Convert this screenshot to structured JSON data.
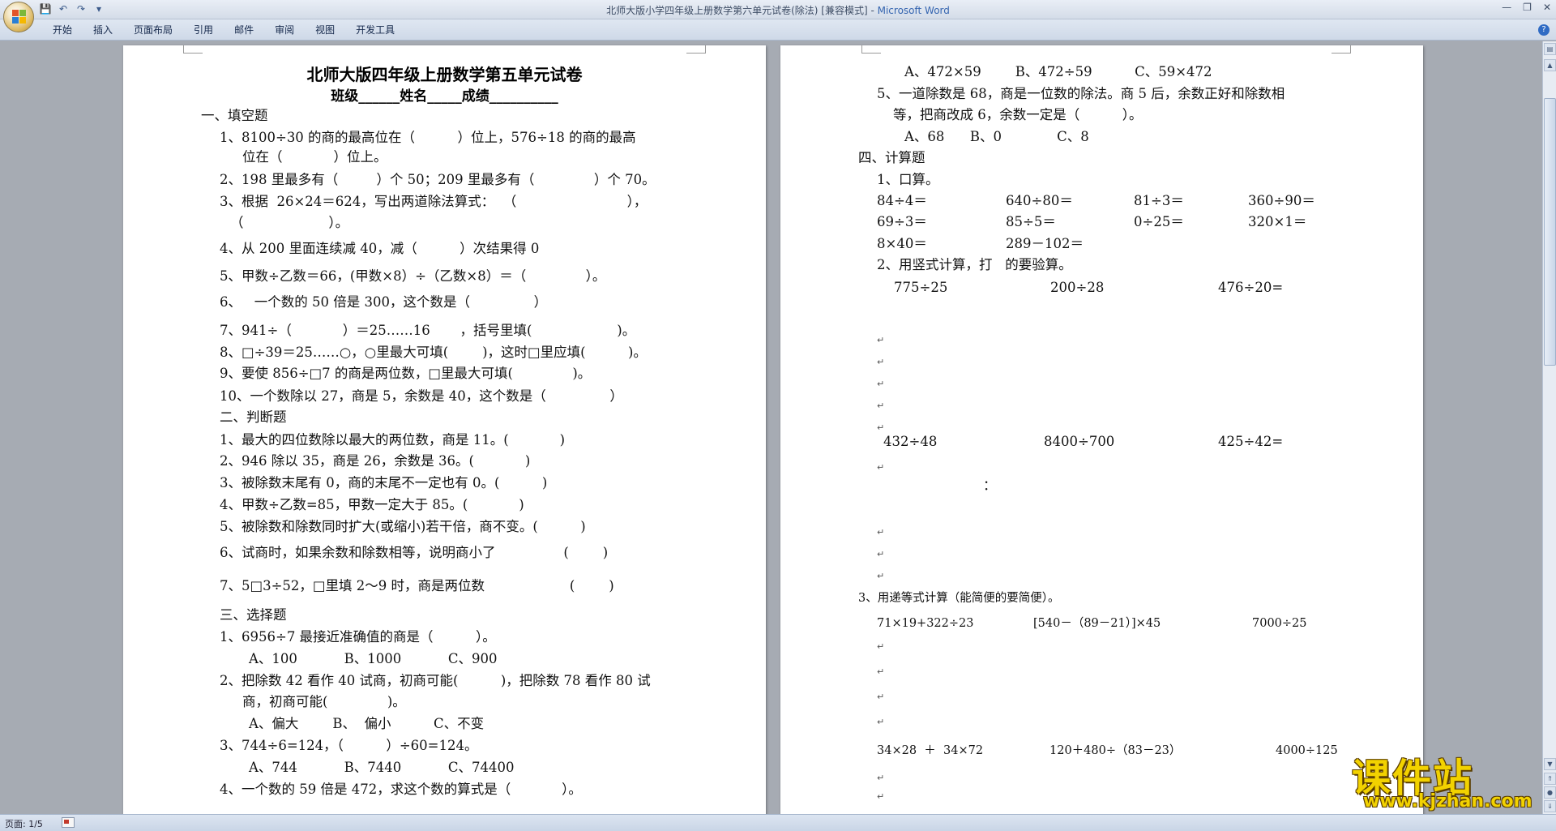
{
  "window": {
    "title": "北师大版小学四年级上册数学第六单元试卷(除法) [兼容模式] - ",
    "app_name": "Microsoft Word",
    "controls": [
      "—",
      "❐",
      "✕"
    ]
  },
  "quick_access": {
    "save_icon": "save-icon",
    "undo_icon": "undo-icon",
    "redo_icon": "redo-icon",
    "more": "▾"
  },
  "ribbon": {
    "tabs": [
      "开始",
      "插入",
      "页面布局",
      "引用",
      "邮件",
      "审阅",
      "视图",
      "开发工具"
    ],
    "help": "?"
  },
  "page1": {
    "title": "北师大版四年级上册数学第五单元试卷",
    "subtitle": "班级______姓名_____成绩__________",
    "lines": [
      "一、填空题",
      "1、8100÷30 的商的最高位在（          ）位上，576÷18 的商的最高",
      "位在（            ）位上。",
      "2、198 里最多有（         ）个 50；209 里最多有（              ）个 70。",
      "3、根据  26×24＝624，写出两道除法算式：  （                          ），",
      "（                    ）。",
      "4、从 200 里面连续减 40，减（          ）次结果得 0",
      "5、甲数÷乙数＝66，(甲数×8）÷（乙数×8）＝（              ）。",
      "6、   一个数的 50 倍是 300，这个数是（               ）",
      "7、941÷（            ）＝25……16       ，括号里填(                    )。",
      "8、□÷39＝25……○，○里最大可填(        )，这时□里应填(          )。",
      "9、要使 856÷□7 的商是两位数，□里最大可填(              )。",
      "10、一个数除以 27，商是 5，余数是 40，这个数是（               ）",
      "二、判断题",
      "1、最大的四位数除以最大的两位数，商是 11。(            )",
      "2、946 除以 35，商是 26，余数是 36。(            )",
      "3、被除数末尾有 0，商的末尾不一定也有 0。(          )",
      "4、甲数÷乙数=85，甲数一定大于 85。(            )",
      "5、被除数和除数同时扩大(或缩小)若干倍，商不变。(          )",
      "6、试商时，如果余数和除数相等，说明商小了                (        )",
      "7、5□3÷52，□里填 2～9 时，商是两位数                    (        )",
      "三、选择题",
      "1、6956÷7 最接近准确值的商是（          ）。",
      "A、100           B、1000           C、900",
      "2、把除数 42 看作 40 试商，初商可能(          )，把除数 78 看作 80 试",
      "商，初商可能(              )。",
      "A、偏大        B、  偏小          C、不变",
      "3、744÷6=124，（          ）÷60=124。",
      "A、744           B、7440           C、74400",
      "4、一个数的 59 倍是 472，求这个数的算式是（            ）。"
    ]
  },
  "page2": {
    "lines": [
      "A、472×59        B、472÷59          C、59×472",
      "5、一道除数是 68，商是一位数的除法。商 5 后，余数正好和除数相",
      "等，把商改成 6，余数一定是（          ）。",
      "A、68      B、0             C、8",
      "四、计算题",
      "1、口算。",
      "84÷4＝",
      "640÷80＝",
      "81÷3＝",
      "360÷90＝",
      "69÷3＝",
      "85÷5＝",
      "0÷25＝",
      "320×1＝",
      "8×40＝",
      "289－102＝",
      "2、用竖式计算，打   的要验算。",
      "775÷25",
      "200÷28",
      "476÷20=",
      "432÷48",
      "8400÷700",
      "425÷42=",
      "：",
      "3、用递等式计算（能简便的要简便）。",
      "71×19+322÷23",
      "[540－（89－21）]×45",
      "7000÷25",
      "34×28  ＋  34×72",
      "120＋480÷（83－23）",
      "4000÷125"
    ],
    "para_mark": "↵"
  },
  "statusbar": {
    "page_info": "页面: 1/5"
  },
  "watermark": {
    "text": "课件站",
    "url": "www.kjzhan.com"
  }
}
